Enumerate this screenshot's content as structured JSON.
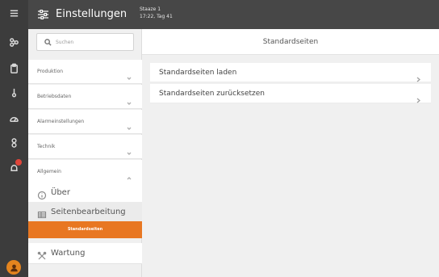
{
  "header": {
    "title": "Einstellungen",
    "status_line1": "Staaze 1",
    "status_line2": "17:22, Tag 41"
  },
  "rail": {
    "icons": [
      "menu-icon",
      "hierarchy-icon",
      "clipboard-icon",
      "thermometer-icon",
      "gauge-icon",
      "person-icon",
      "bell-icon"
    ],
    "notification_badge_color": "#e0453a",
    "avatar_color": "#e4841e"
  },
  "sidebar": {
    "search_placeholder": "Suchen",
    "sections": [
      {
        "label": "Produktion"
      },
      {
        "label": "Betriebsdaten"
      },
      {
        "label": "Alarmeinstellungen"
      },
      {
        "label": "Technik"
      },
      {
        "label": "Allgemein"
      }
    ],
    "sub_items": [
      {
        "label": "Über",
        "icon": "info-icon"
      },
      {
        "label": "Seitenbearbeitung",
        "icon": "grid-icon"
      },
      {
        "label": "Wartung",
        "icon": "tools-icon"
      }
    ],
    "active_leaf": "Standardseiten"
  },
  "content": {
    "title": "Standardseiten",
    "rows": [
      {
        "label": "Standardseiten laden"
      },
      {
        "label": "Standardseiten zurücksetzen"
      }
    ]
  },
  "colors": {
    "accent": "#e87722",
    "topbar": "#474747",
    "rail": "#3c3c3c"
  }
}
